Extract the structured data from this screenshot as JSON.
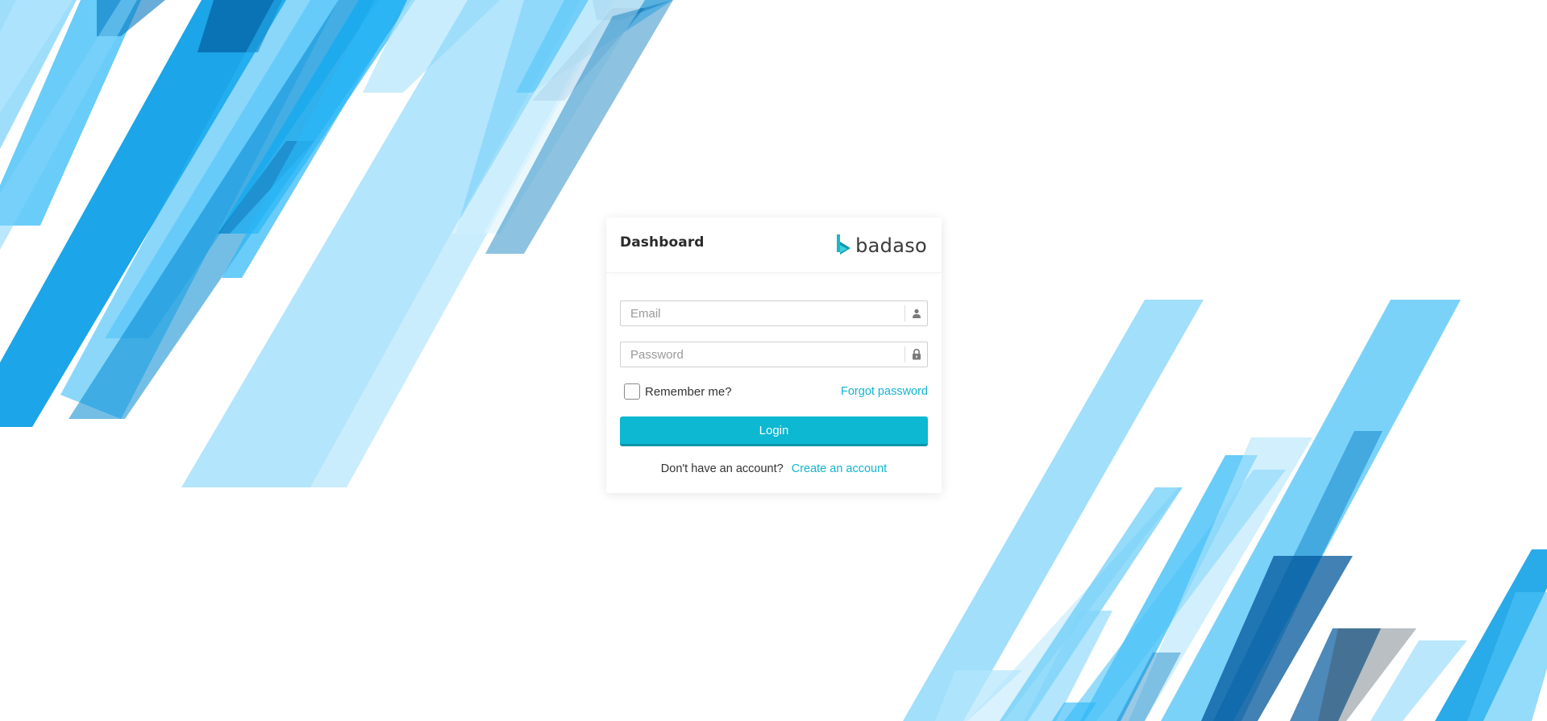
{
  "header": {
    "title": "Dashboard",
    "brand_name": "badaso"
  },
  "form": {
    "email": {
      "placeholder": "Email",
      "value": "",
      "icon": "user-icon"
    },
    "password": {
      "placeholder": "Password",
      "value": "",
      "icon": "lock-icon"
    },
    "remember_label": "Remember me?",
    "remember_checked": false,
    "forgot_label": "Forgot password",
    "login_label": "Login",
    "signup_prompt": "Don't have an account?",
    "signup_link": "Create an account"
  },
  "colors": {
    "accent": "#0cb8d2",
    "link": "#12b4cf",
    "background_stripes": [
      "#039be5",
      "#29b6f6",
      "#4fc3f7",
      "#81d4fa",
      "#b3e5fc",
      "#0277bd",
      "#01579b"
    ]
  }
}
